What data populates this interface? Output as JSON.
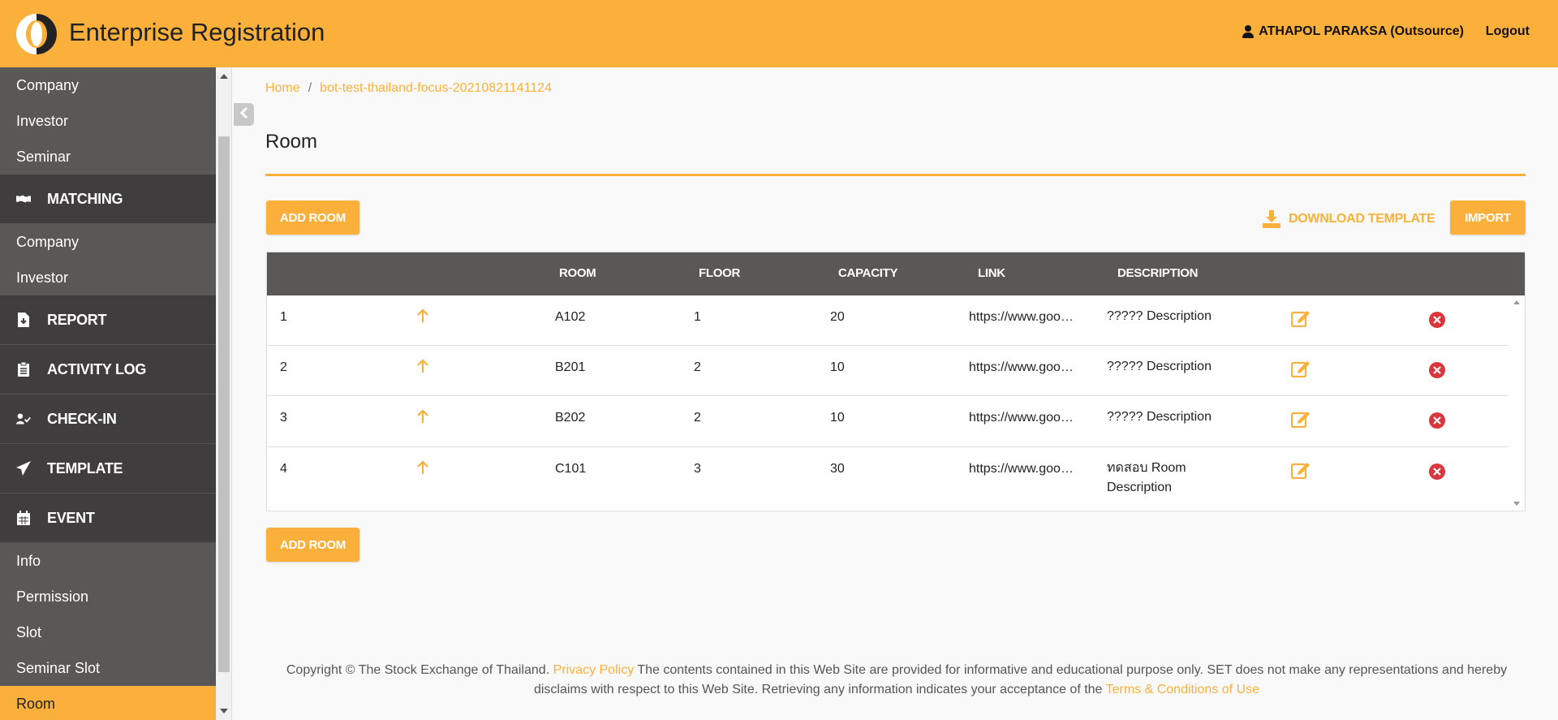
{
  "header": {
    "title": "Enterprise Registration",
    "user": "ATHAPOL PARAKSA (Outsource)",
    "logout": "Logout"
  },
  "sidebar": {
    "items_top": [
      "Company",
      "Investor",
      "Seminar"
    ],
    "matching": {
      "label": "MATCHING",
      "icon": "handshake-icon"
    },
    "matching_items": [
      "Company",
      "Investor"
    ],
    "report": {
      "label": "REPORT",
      "icon": "file-download-icon"
    },
    "activity_log": {
      "label": "ACTIVITY LOG",
      "icon": "clipboard-icon"
    },
    "check_in": {
      "label": "CHECK-IN",
      "icon": "user-check-icon"
    },
    "template": {
      "label": "TEMPLATE",
      "icon": "paper-plane-icon"
    },
    "event": {
      "label": "EVENT",
      "icon": "calendar-icon"
    },
    "event_items": [
      "Info",
      "Permission",
      "Slot",
      "Seminar Slot",
      "Room"
    ],
    "active_item": "Room"
  },
  "breadcrumb": {
    "home": "Home",
    "sep": "/",
    "current": "bot-test-thailand-focus-20210821141124"
  },
  "page": {
    "title": "Room",
    "add_room": "ADD ROOM",
    "download_template": "DOWNLOAD TEMPLATE",
    "import": "IMPORT"
  },
  "table": {
    "columns": [
      "ROOM",
      "FLOOR",
      "CAPACITY",
      "LINK",
      "DESCRIPTION"
    ],
    "rows": [
      {
        "no": "1",
        "room": "A102",
        "floor": "1",
        "capacity": "20",
        "link": "https://www.goo…",
        "description": "????? Description"
      },
      {
        "no": "2",
        "room": "B201",
        "floor": "2",
        "capacity": "10",
        "link": "https://www.goo…",
        "description": "????? Description"
      },
      {
        "no": "3",
        "room": "B202",
        "floor": "2",
        "capacity": "10",
        "link": "https://www.goo…",
        "description": "????? Description"
      },
      {
        "no": "4",
        "room": "C101",
        "floor": "3",
        "capacity": "30",
        "link": "https://www.goo…",
        "description": "ทดสอบ Room Description"
      }
    ]
  },
  "footer": {
    "copyright": "Copyright © The Stock Exchange of Thailand.",
    "privacy": "Privacy Policy",
    "text1": "The contents contained in this Web Site are provided for informative and educational purpose only. SET does not make any representations and hereby disclaims with respect to this Web Site. Retrieving any information indicates your acceptance of the",
    "terms": "Terms & Conditions of Use"
  },
  "colors": {
    "accent": "#fbb03b",
    "sidebar": "#5a5757",
    "sidebar_head": "#3f3d3d",
    "danger": "#d9363e"
  }
}
